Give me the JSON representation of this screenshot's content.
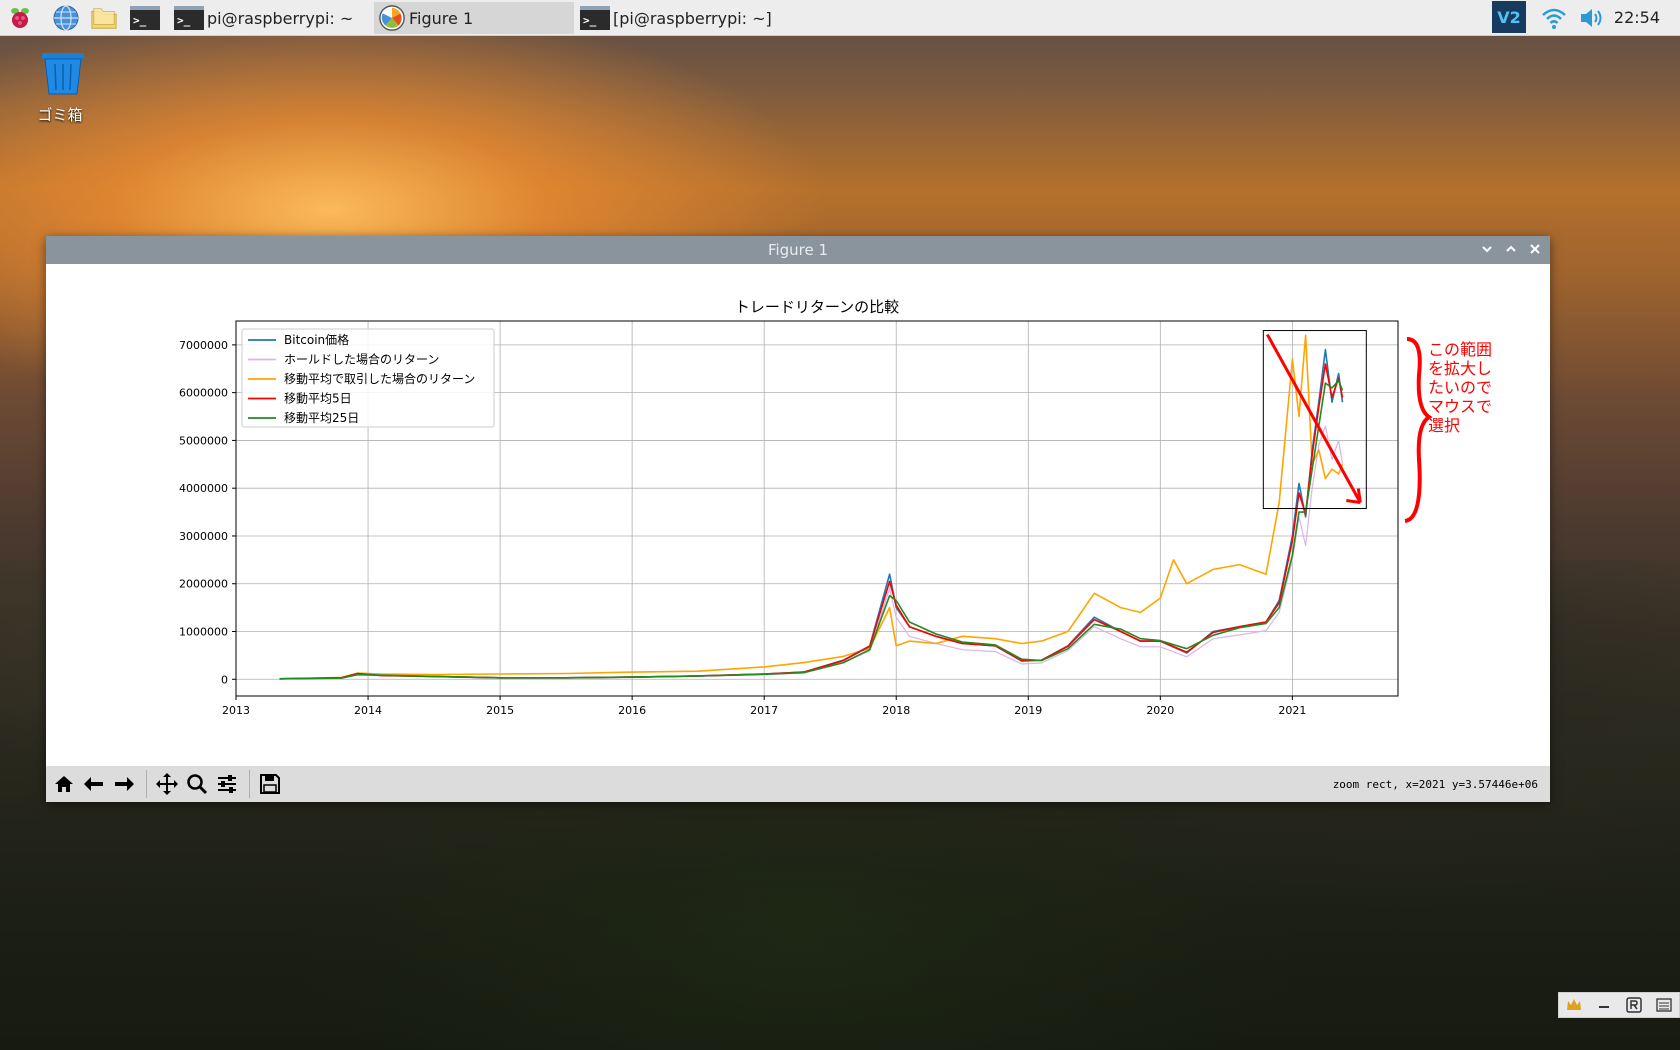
{
  "taskbar": {
    "tasks": [
      {
        "label": "pi@raspberrypi: ~"
      },
      {
        "label": "Figure 1"
      },
      {
        "label": "[pi@raspberrypi: ~]"
      }
    ],
    "clock": "22:54"
  },
  "desktop": {
    "trash_label": "ゴミ箱"
  },
  "window": {
    "title": "Figure 1",
    "status": "zoom rect, x=2021 y=3.57446e+06"
  },
  "annotation": {
    "text_lines": [
      "この範囲",
      "を拡大し",
      "たいので",
      "マウスで",
      "選択"
    ],
    "color": "#ff0000"
  },
  "chart_data": {
    "type": "line",
    "title": "トレードリターンの比較",
    "xlabel": "",
    "ylabel": "",
    "xlim": [
      2013.0,
      2021.8
    ],
    "ylim": [
      -350000,
      7500000
    ],
    "xticks": [
      "2013",
      "2014",
      "2015",
      "2016",
      "2017",
      "2018",
      "2019",
      "2020",
      "2021"
    ],
    "yticks": [
      "0",
      "1000000",
      "2000000",
      "3000000",
      "4000000",
      "5000000",
      "6000000",
      "7000000"
    ],
    "grid": true,
    "legend_position": "upper-left",
    "series": [
      {
        "name": "Bitcoin価格",
        "color": "#1f77b4",
        "x": [
          2013.33,
          2013.8,
          2013.92,
          2014.1,
          2014.5,
          2015.0,
          2015.5,
          2016.0,
          2016.5,
          2017.0,
          2017.3,
          2017.6,
          2017.8,
          2017.95,
          2018.0,
          2018.1,
          2018.3,
          2018.5,
          2018.75,
          2018.95,
          2019.1,
          2019.3,
          2019.5,
          2019.7,
          2019.85,
          2020.0,
          2020.2,
          2020.4,
          2020.6,
          2020.8,
          2020.9,
          2021.0,
          2021.05,
          2021.1,
          2021.15,
          2021.2,
          2021.25,
          2021.3,
          2021.35,
          2021.38
        ],
        "y": [
          10000,
          30000,
          120000,
          80000,
          60000,
          30000,
          30000,
          45000,
          70000,
          110000,
          150000,
          400000,
          700000,
          2200000,
          1500000,
          1100000,
          900000,
          750000,
          700000,
          380000,
          400000,
          700000,
          1300000,
          1000000,
          800000,
          800000,
          550000,
          1000000,
          1100000,
          1200000,
          1650000,
          3000000,
          4100000,
          3400000,
          4800000,
          5800000,
          6900000,
          5800000,
          6400000,
          5800000
        ]
      },
      {
        "name": "ホールドした場合のリターン",
        "color": "#dcb4e6",
        "x": [
          2013.33,
          2013.8,
          2013.92,
          2014.1,
          2014.5,
          2015.0,
          2015.5,
          2016.0,
          2016.5,
          2017.0,
          2017.3,
          2017.6,
          2017.8,
          2017.95,
          2018.0,
          2018.1,
          2018.3,
          2018.5,
          2018.75,
          2018.95,
          2019.1,
          2019.3,
          2019.5,
          2019.7,
          2019.85,
          2020.0,
          2020.2,
          2020.4,
          2020.6,
          2020.8,
          2020.9,
          2021.0,
          2021.05,
          2021.1,
          2021.15,
          2021.2,
          2021.25,
          2021.3,
          2021.35,
          2021.38
        ],
        "y": [
          10000,
          25000,
          100000,
          70000,
          50000,
          25000,
          25000,
          38000,
          60000,
          95000,
          130000,
          340000,
          600000,
          1900000,
          1300000,
          900000,
          750000,
          620000,
          580000,
          320000,
          340000,
          600000,
          1100000,
          850000,
          680000,
          680000,
          470000,
          850000,
          930000,
          1020000,
          1400000,
          2500000,
          3400000,
          2800000,
          4000000,
          4900000,
          5300000,
          4600000,
          5000000,
          4500000
        ]
      },
      {
        "name": "移動平均で取引した場合のリターン",
        "color": "#ffa500",
        "x": [
          2013.33,
          2013.8,
          2013.92,
          2014.1,
          2014.5,
          2015.0,
          2015.5,
          2016.0,
          2016.5,
          2017.0,
          2017.3,
          2017.6,
          2017.8,
          2017.95,
          2018.0,
          2018.1,
          2018.3,
          2018.5,
          2018.75,
          2018.95,
          2019.1,
          2019.3,
          2019.5,
          2019.7,
          2019.85,
          2020.0,
          2020.1,
          2020.2,
          2020.4,
          2020.6,
          2020.8,
          2020.9,
          2021.0,
          2021.05,
          2021.1,
          2021.15,
          2021.2,
          2021.25,
          2021.3,
          2021.35,
          2021.38
        ],
        "y": [
          10000,
          40000,
          130000,
          110000,
          100000,
          110000,
          120000,
          150000,
          170000,
          260000,
          350000,
          480000,
          650000,
          1500000,
          700000,
          800000,
          750000,
          900000,
          850000,
          750000,
          800000,
          1000000,
          1800000,
          1500000,
          1400000,
          1700000,
          2500000,
          2000000,
          2300000,
          2400000,
          2200000,
          3700000,
          6700000,
          5500000,
          7200000,
          4500000,
          4800000,
          4200000,
          4400000,
          4300000,
          4500000
        ]
      },
      {
        "name": "移動平均5日",
        "color": "#ff0000",
        "x": [
          2013.33,
          2013.8,
          2013.92,
          2014.1,
          2014.5,
          2015.0,
          2015.5,
          2016.0,
          2016.5,
          2017.0,
          2017.3,
          2017.6,
          2017.8,
          2017.95,
          2018.0,
          2018.1,
          2018.3,
          2018.5,
          2018.75,
          2018.95,
          2019.1,
          2019.3,
          2019.5,
          2019.7,
          2019.85,
          2020.0,
          2020.2,
          2020.4,
          2020.6,
          2020.8,
          2020.9,
          2021.0,
          2021.05,
          2021.1,
          2021.15,
          2021.2,
          2021.25,
          2021.3,
          2021.35,
          2021.38
        ],
        "y": [
          10000,
          30000,
          115000,
          80000,
          60000,
          30000,
          30000,
          45000,
          70000,
          110000,
          150000,
          390000,
          690000,
          2050000,
          1550000,
          1100000,
          900000,
          750000,
          700000,
          390000,
          400000,
          690000,
          1250000,
          1000000,
          800000,
          800000,
          570000,
          980000,
          1100000,
          1200000,
          1600000,
          2900000,
          3900000,
          3450000,
          4700000,
          5700000,
          6600000,
          5900000,
          6300000,
          5900000
        ]
      },
      {
        "name": "移動平均25日",
        "color": "#228b22",
        "x": [
          2013.33,
          2013.8,
          2013.92,
          2014.1,
          2014.5,
          2015.0,
          2015.5,
          2016.0,
          2016.5,
          2017.0,
          2017.3,
          2017.6,
          2017.8,
          2017.95,
          2018.0,
          2018.1,
          2018.3,
          2018.5,
          2018.75,
          2018.95,
          2019.1,
          2019.3,
          2019.5,
          2019.7,
          2019.85,
          2020.0,
          2020.2,
          2020.4,
          2020.6,
          2020.8,
          2020.9,
          2021.0,
          2021.05,
          2021.1,
          2021.15,
          2021.2,
          2021.25,
          2021.3,
          2021.35,
          2021.38
        ],
        "y": [
          10000,
          25000,
          95000,
          85000,
          60000,
          32000,
          32000,
          45000,
          68000,
          105000,
          140000,
          350000,
          620000,
          1750000,
          1650000,
          1200000,
          950000,
          780000,
          720000,
          420000,
          390000,
          640000,
          1150000,
          1050000,
          850000,
          810000,
          640000,
          920000,
          1080000,
          1170000,
          1500000,
          2600000,
          3500000,
          3500000,
          4400000,
          5300000,
          6200000,
          6100000,
          6250000,
          6050000
        ]
      }
    ]
  }
}
